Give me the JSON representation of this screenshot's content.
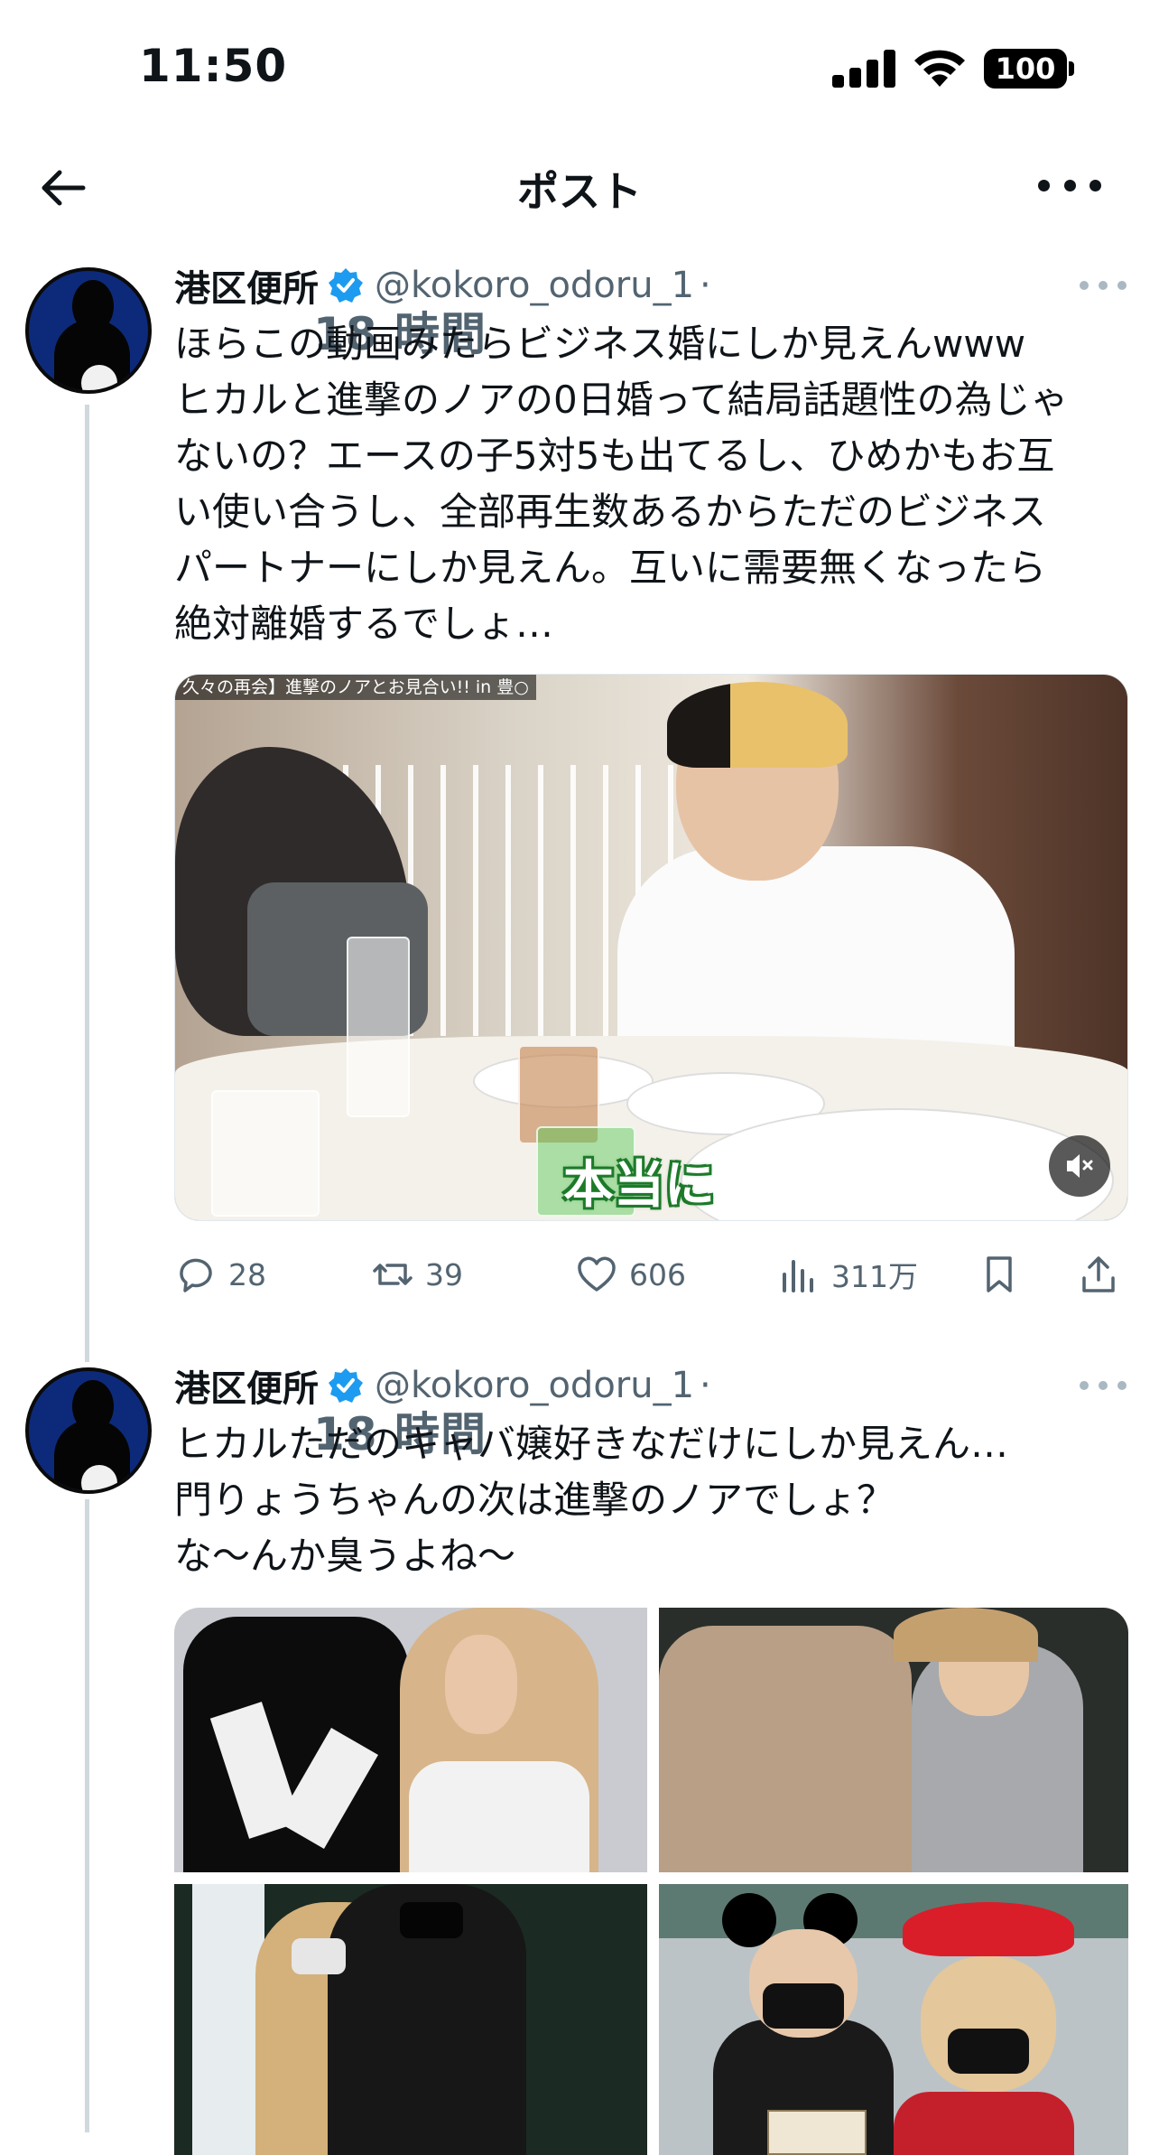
{
  "status_bar": {
    "time": "11:50",
    "battery": "100"
  },
  "nav": {
    "title": "ポスト"
  },
  "posts": [
    {
      "name": "港区便所",
      "handle": "@kokoro_odoru_1",
      "separator": "·",
      "time": "18 時間",
      "text": "ほらこの動画みたらビジネス婚にしか見えんwww\nヒカルと進撃のノアの0日婚って結局話題性の為じゃ\nないの？エースの子5対5も出てるし、ひめかもお互\nい使い合うし、全部再生数あるからただのビジネス\nパートナーにしか見えん。互いに需要無くなったら\n絶対離婚するでしょ…",
      "video": {
        "banner": "久々の再会】進撃のノアとお見合い!! in 豊○",
        "caption": "本当に"
      },
      "metrics": {
        "replies": "28",
        "reposts": "39",
        "likes": "606",
        "views": "311万"
      }
    },
    {
      "name": "港区便所",
      "handle": "@kokoro_odoru_1",
      "separator": "·",
      "time": "18 時間",
      "text": "ヒカルただのキャバ嬢好きなだけにしか見えん…\n門りょうちゃんの次は進撃のノアでしょ？\nな〜んか臭うよね〜"
    }
  ],
  "icons": {
    "verified": "verified-badge-icon",
    "reply": "reply-icon",
    "repost": "repost-icon",
    "like": "heart-icon",
    "views": "views-icon",
    "bookmark": "bookmark-icon",
    "share": "share-icon"
  },
  "colors": {
    "verified": "#1d9bf0",
    "secondary_text": "#536471",
    "thread_line": "#cfd9de"
  }
}
